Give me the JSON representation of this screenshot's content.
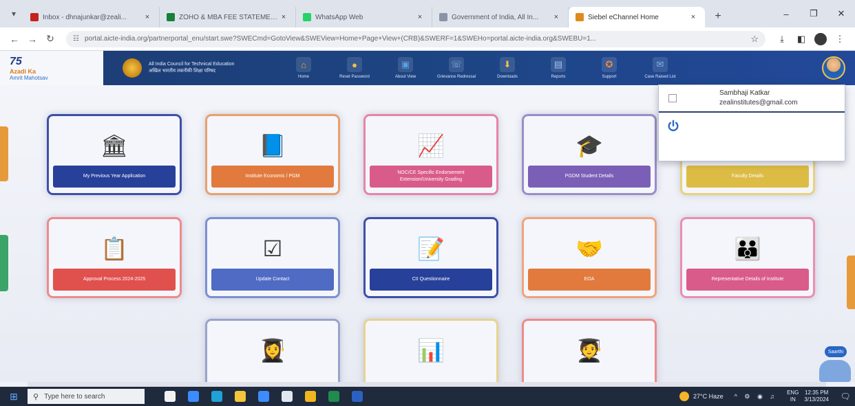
{
  "browser": {
    "tabs": [
      {
        "label": "Inbox - dhnajunkar@zeali...",
        "favicon_color": "#c5221f",
        "active": false
      },
      {
        "label": "ZOHO & MBA FEE STATEMENT...",
        "favicon_color": "#188038",
        "active": false
      },
      {
        "label": "WhatsApp Web",
        "favicon_color": "#25d366",
        "active": false
      },
      {
        "label": "Government of India, All In...",
        "favicon_color": "#8a94a6",
        "active": false
      },
      {
        "label": "Siebel eChannel Home",
        "favicon_color": "#e08a1e",
        "active": true
      }
    ],
    "tab_close": "×",
    "new_tab": "+",
    "window_controls": {
      "minimize": "–",
      "maximize": "❐",
      "close": "✕"
    },
    "nav": {
      "back": "←",
      "forward": "→",
      "reload": "↻"
    },
    "url": "portal.aicte-india.org/partnerportal_enu/start.swe?SWECmd=GotoView&SWEView=Home+Page+View+(CRB)&SWERF=1&SWEHo=portal.aicte-india.org&SWEBU=1...",
    "site_info_icon": "☷",
    "bookmark_icon": "☆",
    "toolbar_icons": [
      "⤓",
      "◧"
    ],
    "menu_icon": "⋮"
  },
  "site": {
    "azadi_logo": {
      "line1": "75",
      "line2": "Azadi Ka",
      "line3": "Amrit Mahotsav"
    },
    "aicte_name_en": "All India Council for Technical Education",
    "aicte_name_hi": "अखिल भारतीय तकनीकी शिक्षा परिषद",
    "nav": [
      {
        "label": "Home",
        "icon": "home-icon",
        "glyph": "⌂",
        "color": "#f4a52a"
      },
      {
        "label": "Reset Password",
        "icon": "key-icon",
        "glyph": "●",
        "color": "#f2c04b"
      },
      {
        "label": "About View",
        "icon": "monitor-icon",
        "glyph": "▣",
        "color": "#5aa0e6"
      },
      {
        "label": "Grievance Redressal",
        "icon": "helpdesk-icon",
        "glyph": "☏",
        "color": "#7fb2e8"
      },
      {
        "label": "Downloads",
        "icon": "download-icon",
        "glyph": "⬇",
        "color": "#f2c04b"
      },
      {
        "label": "Reports",
        "icon": "reports-icon",
        "glyph": "▤",
        "color": "#9dc4ef"
      },
      {
        "label": "Support",
        "icon": "support-icon",
        "glyph": "✪",
        "color": "#f08a3c"
      },
      {
        "label": "Case Raised List",
        "icon": "mail-icon",
        "glyph": "✉",
        "color": "#7fb2e8"
      }
    ]
  },
  "user_menu": {
    "name": "Sambhaji Katkar",
    "email": "zealinstitutes@gmail.com",
    "power_icon": "power-icon"
  },
  "tiles": [
    {
      "label": "My Previous Year Application",
      "icon": "institution-document-icon",
      "border": "#3d4fa6",
      "band": "#27409a"
    },
    {
      "label": "Institute Economic / PGM",
      "icon": "economics-book-icon",
      "border": "#e9a06c",
      "band": "#e27a3e"
    },
    {
      "label": "NOC/CE Specific Endorsement Extension/University Grading",
      "icon": "endorsement-growth-icon",
      "border": "#e883a8",
      "band": "#d95b8a"
    },
    {
      "label": "PGDM Student Details",
      "icon": "graduation-cap-icon",
      "border": "#9a8cc9",
      "band": "#7b5fb7"
    },
    {
      "label": "Faculty Details",
      "icon": "faculty-icon",
      "border": "#e8d27a",
      "band": "#dcbc45"
    },
    {
      "label": "Approval Process 2024-2025",
      "icon": "approval-document-icon",
      "border": "#ee8a8a",
      "band": "#e0504d"
    },
    {
      "label": "Update Contact",
      "icon": "checklist-icon",
      "border": "#7c8fd0",
      "band": "#4f6bc4"
    },
    {
      "label": "CII Questionnaire",
      "icon": "questionnaire-icon",
      "border": "#3d4fa6",
      "band": "#27409a"
    },
    {
      "label": "EOA",
      "icon": "handshake-icon",
      "border": "#f1a37a",
      "band": "#e27a3e"
    },
    {
      "label": "Representative Details of Institute",
      "icon": "team-icon",
      "border": "#ea8eb0",
      "band": "#d95b8a"
    },
    {
      "label": "",
      "icon": "student-icon",
      "border": "#9aa3c9",
      "band": ""
    },
    {
      "label": "",
      "icon": "analytics-icon",
      "border": "#e8d38f",
      "band": ""
    },
    {
      "label": "",
      "icon": "scholar-icon",
      "border": "#ee8a8a",
      "band": ""
    }
  ],
  "scroll_arrows": {
    "up": "⌃",
    "down": "⌄"
  },
  "chatbot": {
    "label": "Saarthi"
  },
  "taskbar": {
    "start_icon": "⊞",
    "search_placeholder": "Type here to search",
    "search_icon": "⚲",
    "apps": [
      {
        "icon": "widgets-icon",
        "color": "#f2f2f2"
      },
      {
        "icon": "task-view-icon",
        "color": "#3d8bff"
      },
      {
        "icon": "edge-icon",
        "color": "#1fa2d6"
      },
      {
        "icon": "file-explorer-icon",
        "color": "#f3c53a"
      },
      {
        "icon": "mail-app-icon",
        "color": "#3d8bff"
      },
      {
        "icon": "store-icon",
        "color": "#e2e7ef"
      },
      {
        "icon": "chrome-icon",
        "color": "#f2b51f"
      },
      {
        "icon": "excel-icon",
        "color": "#1f8c4e"
      },
      {
        "icon": "word-icon",
        "color": "#2b62c2"
      }
    ],
    "weather": "27°C Haze",
    "tray_icons": "^ ⚙ ◉ ♫",
    "lang": "ENG",
    "region": "IN",
    "time": "12:35 PM",
    "date": "3/13/2024",
    "notification_icon": "🗨"
  }
}
